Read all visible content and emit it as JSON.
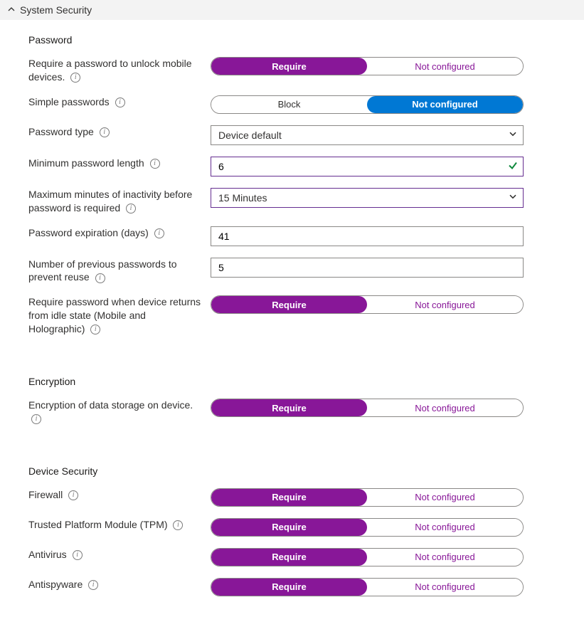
{
  "header": {
    "title": "System Security"
  },
  "groups": {
    "password": {
      "title": "Password"
    },
    "encryption": {
      "title": "Encryption"
    },
    "device": {
      "title": "Device Security"
    }
  },
  "options": {
    "require": "Require",
    "not_configured": "Not configured",
    "block": "Block"
  },
  "rows": {
    "require_password": {
      "label": "Require a password to unlock mobile devices."
    },
    "simple_passwords": {
      "label": "Simple passwords"
    },
    "password_type": {
      "label": "Password type",
      "value": "Device default"
    },
    "min_length": {
      "label": "Minimum password length",
      "value": "6"
    },
    "max_inactive": {
      "label": "Maximum minutes of inactivity before password is required",
      "value": "15 Minutes"
    },
    "expiration": {
      "label": "Password expiration (days)",
      "value": "41"
    },
    "prev_passwords": {
      "label": "Number of previous passwords to prevent reuse",
      "value": "5"
    },
    "idle_return": {
      "label": "Require password when device returns from idle state (Mobile and Holographic)"
    },
    "encryption_storage": {
      "label": "Encryption of data storage on device."
    },
    "firewall": {
      "label": "Firewall"
    },
    "tpm": {
      "label": "Trusted Platform Module (TPM)"
    },
    "antivirus": {
      "label": "Antivirus"
    },
    "antispyware": {
      "label": "Antispyware"
    }
  }
}
